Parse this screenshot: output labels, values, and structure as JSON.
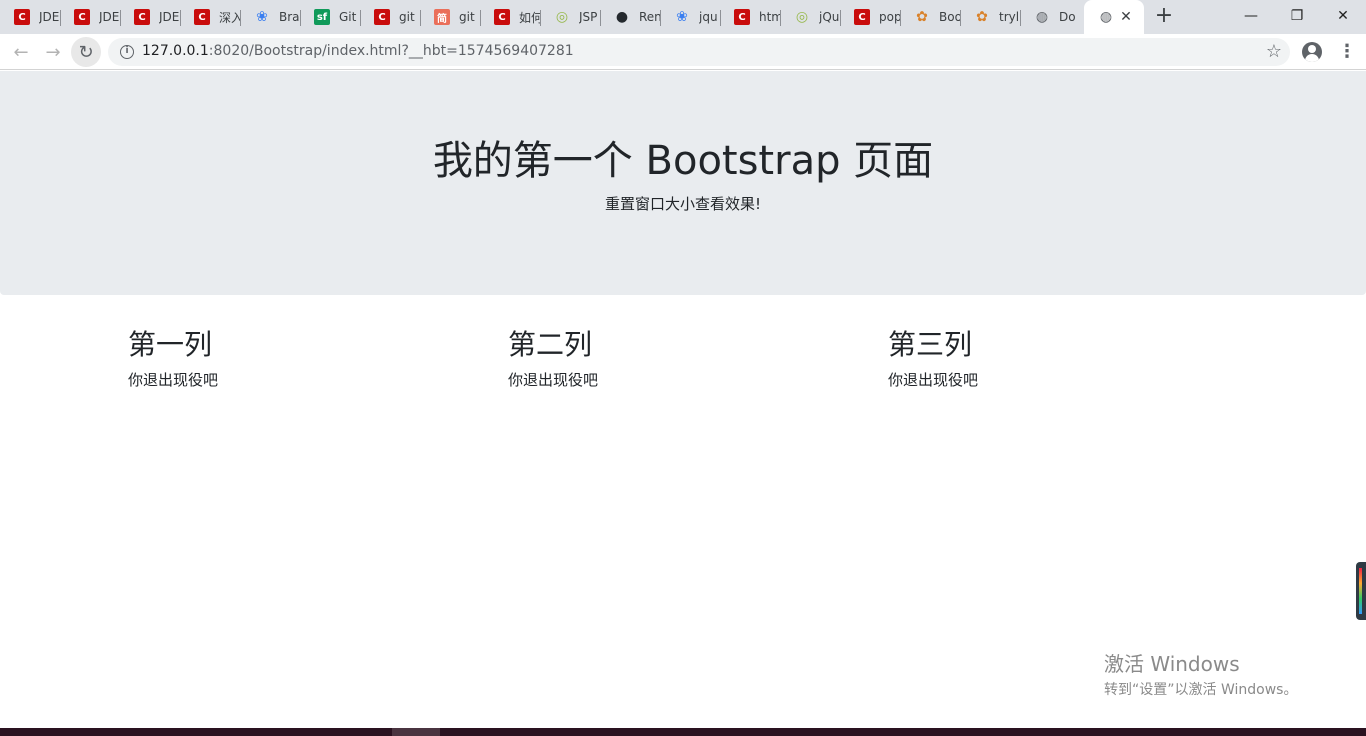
{
  "browser": {
    "tabs": [
      {
        "title": "JDE",
        "icon": "csdn-icon",
        "color": "#c90c0c",
        "glyph": "C"
      },
      {
        "title": "JDE",
        "icon": "csdn-icon",
        "color": "#c90c0c",
        "glyph": "C"
      },
      {
        "title": "JDE",
        "icon": "csdn-icon",
        "color": "#c90c0c",
        "glyph": "C"
      },
      {
        "title": "深入",
        "icon": "csdn-icon",
        "color": "#c90c0c",
        "glyph": "C"
      },
      {
        "title": "Bra",
        "icon": "baidu-paw-icon",
        "color": "#3b7ff0",
        "glyph": "❀"
      },
      {
        "title": "Git",
        "icon": "segmentfault-icon",
        "color": "#109a5a",
        "glyph": "sf"
      },
      {
        "title": "git",
        "icon": "csdn-icon",
        "color": "#c90c0c",
        "glyph": "C"
      },
      {
        "title": "git",
        "icon": "jianshu-icon",
        "color": "#ea6f5a",
        "glyph": "简"
      },
      {
        "title": "如何",
        "icon": "csdn-icon",
        "color": "#c90c0c",
        "glyph": "C"
      },
      {
        "title": "JSP",
        "icon": "runoob-icon",
        "color": "#96b84b",
        "glyph": "◎"
      },
      {
        "title": "Ren",
        "icon": "github-icon",
        "color": "#24292e",
        "glyph": "●"
      },
      {
        "title": "jqu",
        "icon": "baidu-paw-icon",
        "color": "#3b7ff0",
        "glyph": "❀"
      },
      {
        "title": "htm",
        "icon": "csdn-icon",
        "color": "#c90c0c",
        "glyph": "C"
      },
      {
        "title": "jQu",
        "icon": "runoob-icon",
        "color": "#96b84b",
        "glyph": "◎"
      },
      {
        "title": "pop",
        "icon": "csdn-icon",
        "color": "#c90c0c",
        "glyph": "C"
      },
      {
        "title": "Boo",
        "icon": "settings-flower-icon",
        "color": "#d9822b",
        "glyph": "✿"
      },
      {
        "title": "tryl",
        "icon": "settings-flower-icon",
        "color": "#d9822b",
        "glyph": "✿"
      },
      {
        "title": "Do",
        "icon": "globe-icon",
        "color": "#5f6368",
        "glyph": "◍"
      }
    ],
    "active_tab": {
      "icon": "globe-icon",
      "color": "#5f6368",
      "glyph": "◍",
      "close": "✕"
    },
    "new_tab": "+",
    "window_controls": {
      "minimize": "—",
      "restore": "❐",
      "close": "✕"
    },
    "nav": {
      "back": "←",
      "forward": "→",
      "reload": "↻"
    },
    "url_host": "127.0.0.1",
    "url_rest": ":8020/Bootstrap/index.html?__hbt=1574569407281",
    "info": "i",
    "bookmark_star": "☆",
    "menu": "⋮"
  },
  "jumbotron": {
    "title": "我的第一个 Bootstrap 页面",
    "subtitle": "重置窗口大小查看效果!"
  },
  "columns": [
    {
      "heading": "第一列",
      "text": "你退出现役吧"
    },
    {
      "heading": "第二列",
      "text": "你退出现役吧"
    },
    {
      "heading": "第三列",
      "text": "你退出现役吧"
    }
  ],
  "watermark": {
    "line1": "激活 Windows",
    "line2": "转到“设置”以激活 Windows。"
  }
}
